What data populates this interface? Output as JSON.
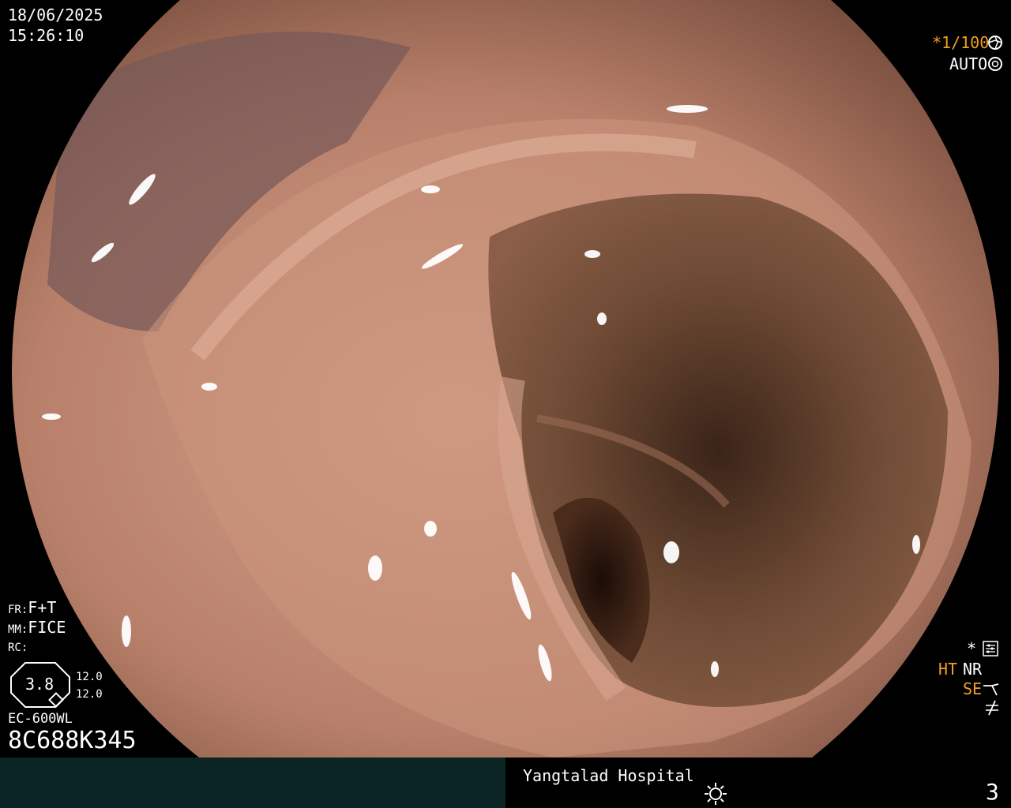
{
  "overlay": {
    "date": "18/06/2025",
    "time": "15:26:10",
    "shutter": "*1/100",
    "exposure_mode": "AUTO",
    "fr_label": "FR:",
    "fr_value": "F+T",
    "mm_label": "MM:",
    "mm_value": "FICE",
    "rc_label": "RC:",
    "zoom_value": "3.8",
    "scale_top": "12.0",
    "scale_bottom": "12.0",
    "scope_model": "EC-600WL",
    "scope_serial": "8C688K345",
    "right_star": "*",
    "ht": "HT",
    "nr": "NR",
    "se": "SE"
  },
  "footer": {
    "hospital": "Yangtalad Hospital",
    "image_number": "3"
  },
  "icons": [
    "aperture-icon",
    "camera-lens-icon",
    "settings-sliders-icon",
    "edge-enhance-icon",
    "signal-off-icon",
    "sun-icon"
  ],
  "colors": {
    "accent": "#f0a020",
    "footer_bg": "#0b2424",
    "mucosa": "#c08a74"
  }
}
